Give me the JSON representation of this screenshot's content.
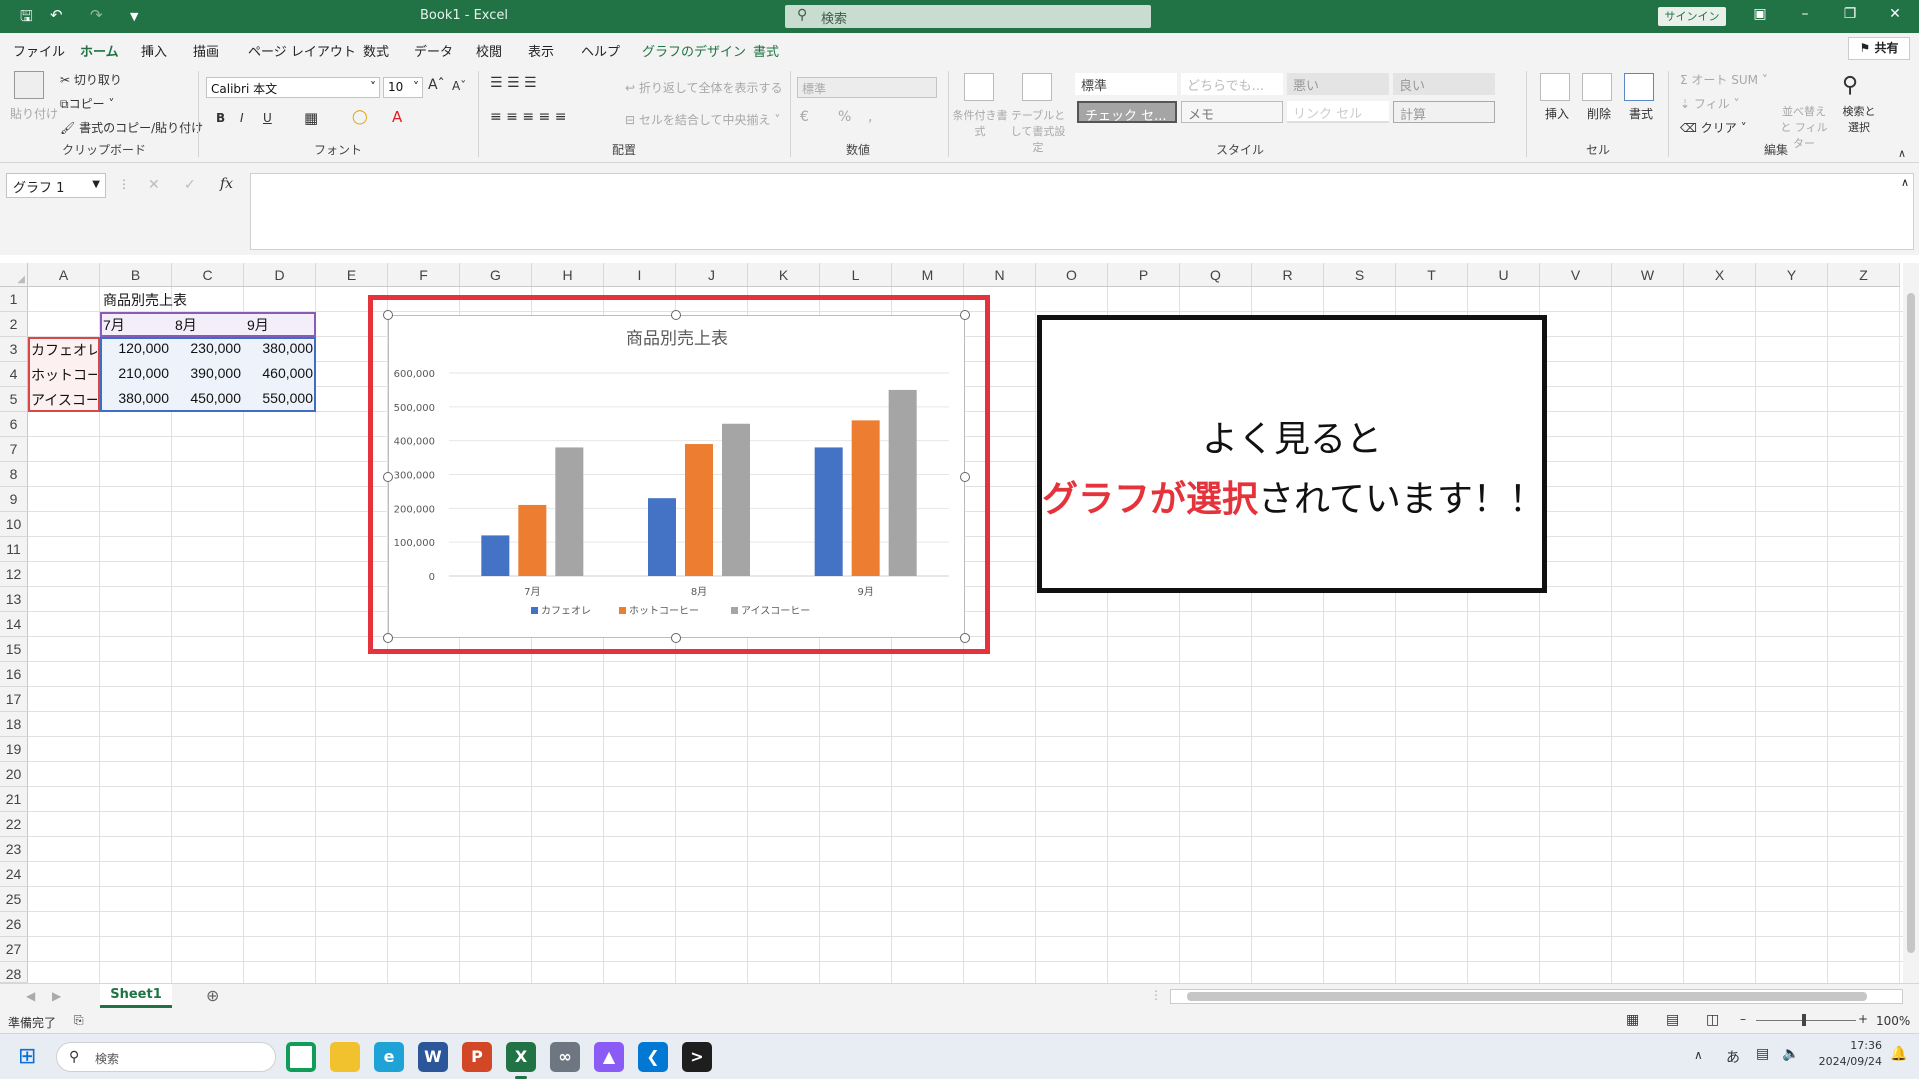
{
  "titlebar": {
    "doc_title": "Book1 - Excel",
    "search_placeholder": "検索",
    "signin": "サインイン"
  },
  "menu": {
    "items": [
      "ファイル",
      "ホーム",
      "挿入",
      "描画",
      "ページ レイアウト",
      "数式",
      "データ",
      "校閲",
      "表示",
      "ヘルプ",
      "グラフのデザイン",
      "書式"
    ],
    "active": "ホーム",
    "share": "共有"
  },
  "ribbon": {
    "clipboard": {
      "paste": "貼り付け",
      "cut": "切り取り",
      "copy": "コピー",
      "format_painter": "書式のコピー/貼り付け",
      "group": "クリップボード"
    },
    "font": {
      "name": "Calibri 本文",
      "size": "10",
      "group": "フォント",
      "bold": "B",
      "italic": "I",
      "underline": "U"
    },
    "alignment": {
      "wrap": "折り返して全体を表示する",
      "merge": "セルを結合して中央揃え",
      "group": "配置"
    },
    "number": {
      "format": "標準",
      "percent": "%",
      "group": "数値"
    },
    "styles": {
      "conditional": "条件付き書式",
      "table": "テーブルとして書式設定",
      "cells": [
        "標準",
        "どちらでも...",
        "悪い",
        "良い",
        "チェック セ...",
        "メモ",
        "リンク セル",
        "計算"
      ],
      "group": "スタイル"
    },
    "cells": {
      "insert": "挿入",
      "delete": "削除",
      "format": "書式",
      "group": "セル"
    },
    "editing": {
      "autosum": "オート SUM",
      "fill": "フィル",
      "clear": "クリア",
      "sort": "並べ替えと フィルター",
      "find": "検索と 選択",
      "group": "編集"
    }
  },
  "formula_bar": {
    "name_box": "グラフ 1",
    "fx": "fx",
    "value": ""
  },
  "columns": [
    "A",
    "B",
    "C",
    "D",
    "E",
    "F",
    "G",
    "H",
    "I",
    "J",
    "K",
    "L",
    "M",
    "N",
    "O",
    "P",
    "Q",
    "R",
    "S",
    "T",
    "U",
    "V",
    "W",
    "X",
    "Y",
    "Z"
  ],
  "rows": [
    "1",
    "2",
    "3",
    "4",
    "5",
    "6",
    "7",
    "8",
    "9",
    "10",
    "11",
    "12",
    "13",
    "14",
    "15",
    "16",
    "17",
    "18",
    "19",
    "20",
    "21",
    "22",
    "23",
    "24",
    "25",
    "26",
    "27",
    "28"
  ],
  "table": {
    "title": "商品別売上表",
    "months": [
      "7月",
      "8月",
      "9月"
    ],
    "products": [
      "カフェオレ",
      "ホットコーヒー",
      "アイスコーヒー"
    ],
    "values": [
      [
        "120,000",
        "230,000",
        "380,000"
      ],
      [
        "210,000",
        "390,000",
        "460,000"
      ],
      [
        "380,000",
        "450,000",
        "550,000"
      ]
    ]
  },
  "chart_data": {
    "type": "bar",
    "title": "商品別売上表",
    "categories": [
      "7月",
      "8月",
      "9月"
    ],
    "series": [
      {
        "name": "カフェオレ",
        "values": [
          120000,
          230000,
          380000
        ],
        "color": "#4472c4"
      },
      {
        "name": "ホットコーヒー",
        "values": [
          210000,
          390000,
          460000
        ],
        "color": "#ed7d31"
      },
      {
        "name": "アイスコーヒー",
        "values": [
          380000,
          450000,
          550000
        ],
        "color": "#a5a5a5"
      }
    ],
    "yticks": [
      "0",
      "100,000",
      "200,000",
      "300,000",
      "400,000",
      "500,000",
      "600,000"
    ],
    "ylim": [
      0,
      600000
    ],
    "legend": "bottom",
    "grid": true
  },
  "callout": {
    "line1": "よく見ると",
    "highlight": "グラフが選択",
    "rest": "されています！！"
  },
  "sheets": {
    "active": "Sheet1"
  },
  "status": {
    "ready": "準備完了",
    "zoom": "100%"
  },
  "taskbar": {
    "search": "検索",
    "time": "17:36",
    "date": "2024/09/24",
    "ime": "あ"
  }
}
